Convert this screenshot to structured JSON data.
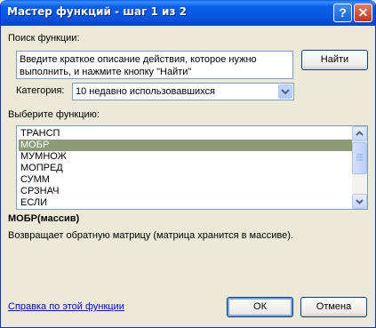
{
  "window": {
    "title": "Мастер функций - шаг 1 из 2",
    "help_button": "?",
    "close_button": "✕"
  },
  "search": {
    "label": "Поиск функции:",
    "description": "Введите краткое описание действия, которое нужно выполнить, и нажмите кнопку \"Найти\"",
    "find_button": "Найти"
  },
  "category": {
    "label": "Категория:",
    "selected": "10 недавно использовавшихся"
  },
  "function_list": {
    "label": "Выберите функцию:",
    "items": [
      "ТРАНСП",
      "МОБР",
      "МУМНОЖ",
      "МОПРЕД",
      "СУММ",
      "СРЗНАЧ",
      "ЕСЛИ"
    ],
    "selected_index": 1
  },
  "details": {
    "signature": "МОБР(массив)",
    "description": "Возвращает обратную матрицу (матрица хранится в массиве)."
  },
  "footer": {
    "help_link": "Справка по этой функции",
    "ok_button": "ОК",
    "cancel_button": "Отмена"
  },
  "colors": {
    "titlebar": "#0A5FEA",
    "dialog_bg": "#ECE9D8",
    "selection": "#8C9A78",
    "link": "#0000FF"
  }
}
